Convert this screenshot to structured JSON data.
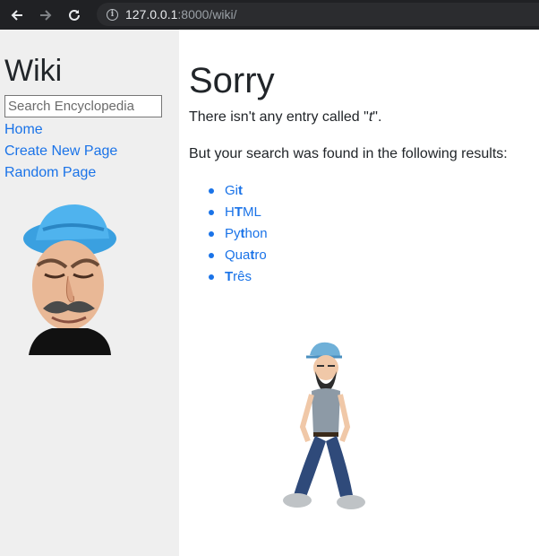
{
  "browser": {
    "url_host": "127.0.0.1",
    "url_rest": ":8000/wiki/"
  },
  "sidebar": {
    "title": "Wiki",
    "search_placeholder": "Search Encyclopedia",
    "links": [
      "Home",
      "Create New Page",
      "Random Page"
    ]
  },
  "main": {
    "heading": "Sorry",
    "message_prefix": "There isn't any entry called \"",
    "query": "t",
    "message_suffix": "\".",
    "results_intro": "But your search was found in the following results:",
    "results": [
      {
        "pre": "Gi",
        "match": "t",
        "post": ""
      },
      {
        "pre": "H",
        "match": "T",
        "post": "ML"
      },
      {
        "pre": "Py",
        "match": "t",
        "post": "hon"
      },
      {
        "pre": "Qua",
        "match": "t",
        "post": "ro"
      },
      {
        "pre": "",
        "match": "T",
        "post": "rês"
      }
    ]
  },
  "colors": {
    "link": "#1a73e8",
    "sidebar_bg": "#efefef",
    "chrome_bg": "#202124"
  }
}
